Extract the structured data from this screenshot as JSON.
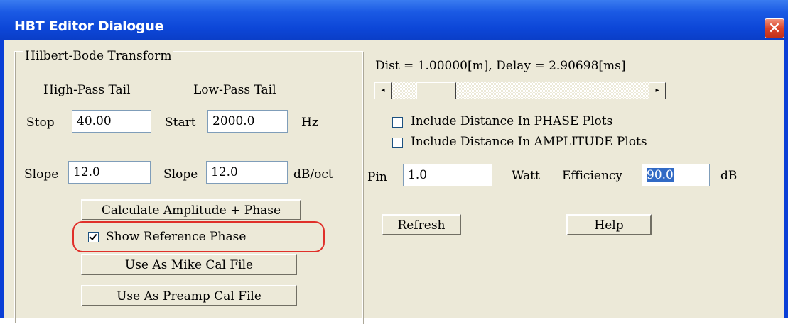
{
  "window": {
    "title": "HBT Editor Dialogue",
    "close_symbol": "✕",
    "accent": "#0a3ec8",
    "highlight_color": "#e0302a"
  },
  "group": {
    "title": "Hilbert-Bode Transform",
    "high_pass_heading": "High-Pass Tail",
    "low_pass_heading": "Low-Pass Tail",
    "stop_label": "Stop",
    "stop_value": "40.00",
    "start_label": "Start",
    "start_value": "2000.0",
    "hz_unit": "Hz",
    "slope_label_hp": "Slope",
    "slope_value_hp": "12.0",
    "slope_label_lp": "Slope",
    "slope_value_lp": "12.0",
    "slope_unit": "dB/oct",
    "calc_button": "Calculate Amplitude + Phase",
    "show_ref_phase_label": "Show Reference Phase",
    "show_ref_phase_checked": true,
    "mike_cal_button": "Use As Mike Cal File",
    "preamp_cal_button": "Use As Preamp Cal File"
  },
  "right": {
    "dist_delay_text": "Dist = 1.00000[m], Delay = 2.90698[ms]",
    "scroll_left": "◂",
    "scroll_right": "▸",
    "include_phase_label": "Include Distance In PHASE Plots",
    "include_phase_checked": false,
    "include_amplitude_label": "Include Distance In AMPLITUDE Plots",
    "include_amplitude_checked": false,
    "pin_label": "Pin",
    "pin_value": "1.0",
    "watt_unit": "Watt",
    "efficiency_label": "Efficiency",
    "efficiency_value": "90.0",
    "db_unit": "dB",
    "refresh_button": "Refresh",
    "help_button": "Help"
  }
}
